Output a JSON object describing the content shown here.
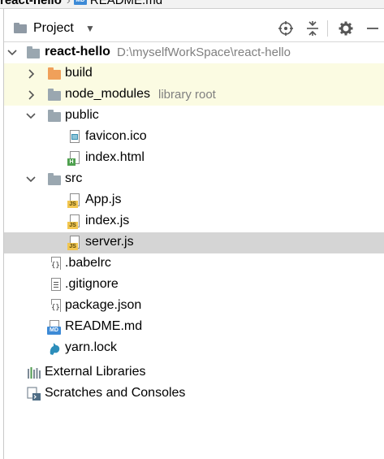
{
  "breadcrumb": {
    "project": "react-hello",
    "file": "README.md",
    "file_badge": "MD"
  },
  "toolbar": {
    "title": "Project",
    "icons": [
      "globe-target-icon",
      "collapse-all-icon",
      "gear-icon",
      "minimize-icon"
    ]
  },
  "tree": {
    "root": {
      "label": "react-hello",
      "path": "D:\\myselfWorkSpace\\react-hello"
    },
    "build": {
      "label": "build"
    },
    "node_modules": {
      "label": "node_modules",
      "hint": "library root"
    },
    "public": {
      "label": "public"
    },
    "favicon": {
      "label": "favicon.ico"
    },
    "index_html": {
      "label": "index.html",
      "badge": "H"
    },
    "src": {
      "label": "src"
    },
    "app_js": {
      "label": "App.js",
      "badge": "JS"
    },
    "index_js": {
      "label": "index.js",
      "badge": "JS"
    },
    "server_js": {
      "label": "server.js",
      "badge": "JS"
    },
    "babelrc": {
      "label": ".babelrc",
      "badge": "{}"
    },
    "gitignore": {
      "label": ".gitignore"
    },
    "package_json": {
      "label": "package.json",
      "badge": "{}"
    },
    "readme": {
      "label": "README.md",
      "badge": "MD"
    },
    "yarn_lock": {
      "label": "yarn.lock"
    },
    "external_libraries": {
      "label": "External Libraries"
    },
    "scratches": {
      "label": "Scratches and Consoles"
    }
  },
  "colors": {
    "excluded_folder": "#f0a05a",
    "folder": "#9aa7b0",
    "hint": "#808080",
    "library_highlight": "#fbfbe2",
    "selected_row": "#d5d5d5",
    "js_badge": "#f2c650",
    "md_badge": "#3d8ad6"
  }
}
